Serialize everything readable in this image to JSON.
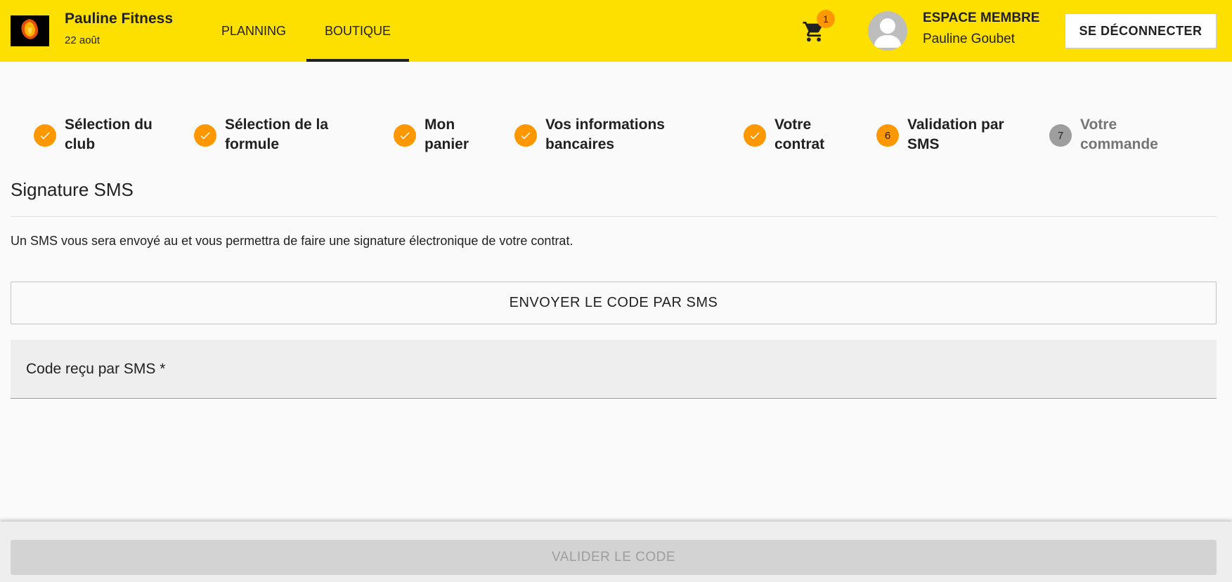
{
  "header": {
    "club_name": "Pauline Fitness",
    "date": "22 août",
    "logo_text": "PAULINE FITNESS",
    "nav": [
      {
        "label": "PLANNING",
        "active": false
      },
      {
        "label": "BOUTIQUE",
        "active": true
      }
    ],
    "cart_count": "1",
    "member_title": "ESPACE MEMBRE",
    "member_name": "Pauline Goubet",
    "logout_label": "SE DÉCONNECTER"
  },
  "steps": [
    {
      "status": "done",
      "label_line1": "Sélection du",
      "label_line2": "club"
    },
    {
      "status": "done",
      "label_line1": "Sélection de la",
      "label_line2": "formule"
    },
    {
      "status": "done",
      "label_line1": "Mon",
      "label_line2": "panier"
    },
    {
      "status": "done",
      "label_line1": "Vos informations",
      "label_line2": "bancaires"
    },
    {
      "status": "done",
      "label_line1": "Votre",
      "label_line2": "contrat"
    },
    {
      "status": "current",
      "number": "6",
      "label_line1": "Validation par",
      "label_line2": "SMS"
    },
    {
      "status": "pending",
      "number": "7",
      "label_line1": "Votre",
      "label_line2": "commande"
    }
  ],
  "main": {
    "title": "Signature SMS",
    "description": "Un SMS vous sera envoyé au et vous permettra de faire une signature électronique de votre contrat.",
    "send_button": "ENVOYER LE CODE PAR SMS",
    "code_label": "Code reçu par SMS *",
    "code_value": ""
  },
  "footer": {
    "validate_button": "VALIDER LE CODE"
  },
  "colors": {
    "header_bg": "#fee000",
    "accent": "#ff9800",
    "pending": "#9e9e9e"
  }
}
